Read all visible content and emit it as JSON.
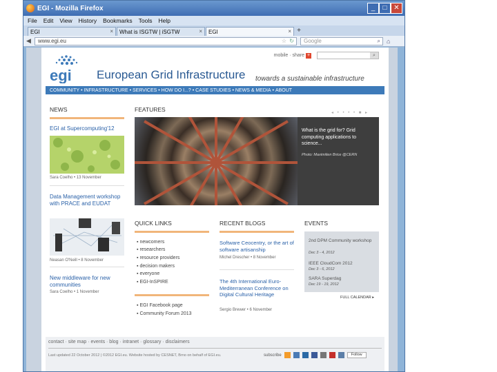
{
  "window": {
    "title": "EGI - Mozilla Firefox",
    "controls": {
      "minimize": "_",
      "maximize": "□",
      "close": "✕"
    }
  },
  "menubar": [
    "File",
    "Edit",
    "View",
    "History",
    "Bookmarks",
    "Tools",
    "Help"
  ],
  "tabs": [
    {
      "label": "EGI",
      "active": false
    },
    {
      "label": "What is ISGTW | iSGTW",
      "active": false
    },
    {
      "label": "EGI",
      "active": true
    }
  ],
  "newtab_label": "+",
  "navbar": {
    "url": "www.egi.eu",
    "search_placeholder": "Google"
  },
  "page": {
    "toplinks": {
      "mobile": "mobile",
      "share": "share"
    },
    "site_name": "European Grid Infrastructure",
    "tagline": "towards a sustainable infrastructure",
    "nav": [
      "COMMUNITY",
      "INFRASTRUCTURE",
      "SERVICES",
      "HOW DO I...?",
      "CASE STUDIES",
      "NEWS & MEDIA",
      "ABOUT"
    ],
    "news": {
      "heading": "NEWS",
      "items": [
        {
          "title": "EGI at Supercomputing'12",
          "meta": "Sara Coelho • 13 November"
        },
        {
          "title": "Data Management workshop with PRACE and EUDAT",
          "meta": "Neasan O'Neill • 8 November"
        },
        {
          "title": "New middleware for new communities",
          "meta": "Sara Coelho • 1 November"
        }
      ]
    },
    "features": {
      "heading": "FEATURES",
      "text": "What is the grid for? Grid computing applications to science...",
      "credit": "Photo: Maximilien Brice @CERN"
    },
    "quick_links": {
      "heading": "QUICK LINKS",
      "items": [
        "newcomers",
        "researchers",
        "resource providers",
        "decision makers",
        "everyone",
        "EGI-InSPIRE"
      ],
      "items2": [
        "EGI Facebook page",
        "Community Forum 2013"
      ]
    },
    "recent_blogs": {
      "heading": "RECENT BLOGS",
      "items": [
        {
          "title": "Software Ceocentry, or the art of software artisanship",
          "meta": "Michel Drescher • 8 November"
        },
        {
          "title": "The 4th International Euro-Mediterranean Conference on Digital Cultural Heritage",
          "meta": "Sergio Brewer • 6 November"
        }
      ]
    },
    "events": {
      "heading": "EVENTS",
      "items": [
        {
          "title": "2nd DPM Community workshop",
          "date": "Dec 3 - 4, 2012"
        },
        {
          "title": "IEEE CloudCom 2012",
          "date": "Dec 3 - 6, 2012"
        },
        {
          "title": "SARA Superdag",
          "date": "Dec 19 - 19, 2012"
        }
      ],
      "full_calendar": "FULL CALENDAR ▸"
    },
    "footer": {
      "links": "contact · site map · events · blog · intranet · glossary · disclaimers",
      "note": "Last updated 22 October 2012 | ©2012 EGI.eu. Website hosted by CESNET, Brno on behalf of EGI.eu.",
      "subscribe": "subscribe",
      "follow": "Follow"
    }
  },
  "colors": {
    "titlebar": "#3f6db3",
    "nav_blue": "#3d7ab9",
    "accent_orange": "#f1b57a",
    "link_blue": "#2a61a8"
  }
}
